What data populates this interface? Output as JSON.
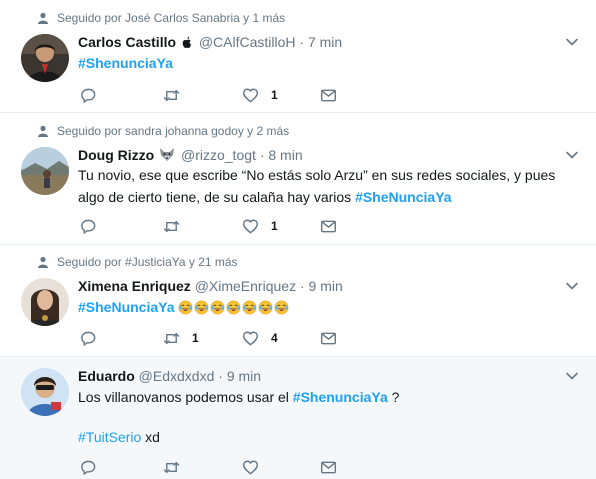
{
  "tweets": [
    {
      "context": "Seguido por José Carlos Sanabria y 1 más",
      "name": "Carlos Castillo",
      "handle": "@CAlfCastilloH",
      "separator": "·",
      "time": "7 min",
      "hashtag": "#ShenunciaYa",
      "like_count": "1"
    },
    {
      "context": "Seguido por sandra johanna godoy y 2 más",
      "name": "Doug Rizzo",
      "handle": "@rizzo_togt",
      "separator": "·",
      "time": "8 min",
      "text_line1": "Tu novio, ese que escribe “No estás solo Arzu” en sus redes sociales, y pues",
      "text_line2": "algo de cierto tiene, de su calaña hay varios ",
      "hashtag": "#SheNunciaYa",
      "like_count": "1"
    },
    {
      "context": "Seguido por #JusticiaYa y 21 más",
      "name": "Ximena Enriquez",
      "handle": "@XimeEnriquez",
      "separator": "·",
      "time": "9 min",
      "hashtag": "#SheNunciaYa",
      "emoji_count": 7,
      "retweet_count": "1",
      "like_count": "4"
    },
    {
      "name": "Eduardo",
      "handle": "@Edxdxdxd",
      "separator": "·",
      "time": "9 min",
      "text_prefix": "Los villanovanos podemos usar el ",
      "hashtag": "#ShenunciaYa",
      "text_suffix": " ?",
      "hashtag2": "#TuitSerio",
      "text2_suffix": " xd"
    }
  ],
  "icons": {
    "person": "person-icon",
    "apple": "apple-icon",
    "wolf": "wolf-emoji",
    "reply": "reply-icon",
    "retweet": "retweet-icon",
    "like": "heart-icon",
    "dm": "envelope-icon",
    "more": "chevron-down-icon",
    "emoji": "tears-of-joy-emoji"
  },
  "colors": {
    "link": "#1da1f2",
    "muted": "#657786",
    "text": "#14171a",
    "highlight_bg": "#f5f8fa",
    "divider": "#e6ecf0"
  }
}
